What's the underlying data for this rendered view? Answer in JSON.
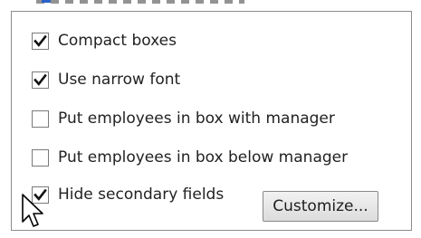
{
  "options": [
    {
      "label": "Compact boxes",
      "checked": true
    },
    {
      "label": "Use narrow font",
      "checked": true
    },
    {
      "label": "Put employees in box with manager",
      "checked": false
    },
    {
      "label": "Put employees in box below manager",
      "checked": false
    },
    {
      "label": "Hide secondary fields",
      "checked": true
    }
  ],
  "customize_button": {
    "label": "Customize..."
  },
  "cursor_icon": "arrow-pointer-icon"
}
